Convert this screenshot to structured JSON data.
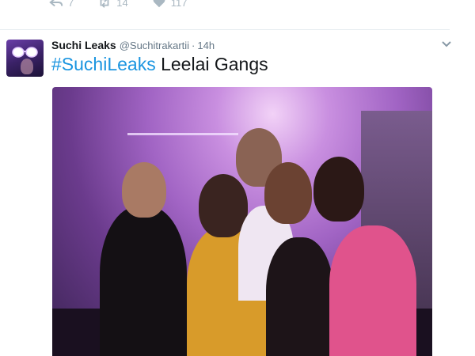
{
  "previous_tweet_actions": [
    {
      "icon": "reply-icon",
      "count": "7"
    },
    {
      "icon": "retweet-icon",
      "count": "14"
    },
    {
      "icon": "like-icon",
      "count": "117"
    }
  ],
  "tweet": {
    "author_name": "Suchi Leaks",
    "author_handle": "@Suchitrakartii",
    "dot": "·",
    "timestamp": "14h",
    "hashtag": "#SuchiLeaks",
    "text": " Leelai Gangs",
    "media": {
      "icon": "photo",
      "colors": {
        "accent": "#1b95e0",
        "purple": "#a164c4"
      }
    }
  }
}
